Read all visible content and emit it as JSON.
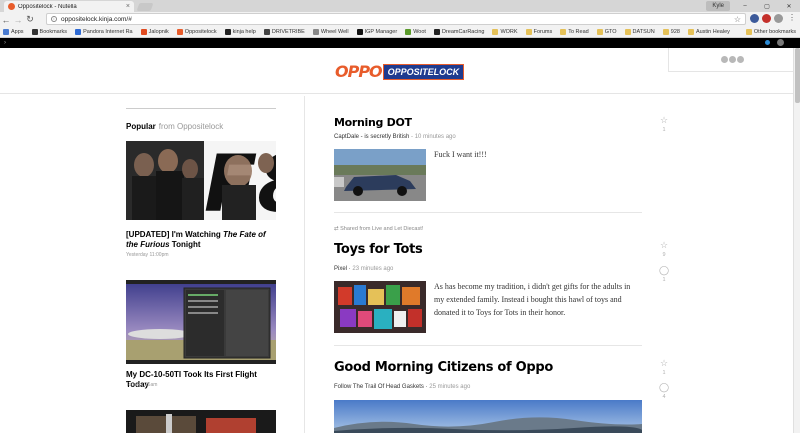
{
  "browser": {
    "tab_title": "Oppositelock - Nutella",
    "user_label": "Kyle",
    "url": "oppositelock.kinja.com/#",
    "bookmarks": [
      {
        "label": "Apps",
        "color": "#4a7bd0"
      },
      {
        "label": "Bookmarks",
        "color": "#333333"
      },
      {
        "label": "Pandora Internet Ra",
        "color": "#2e6ad3"
      },
      {
        "label": "Jalopnik",
        "color": "#e04a1f"
      },
      {
        "label": "Oppositelock",
        "color": "#e85c2b"
      },
      {
        "label": "kinja help",
        "color": "#222222"
      },
      {
        "label": "DRIVETRIBE",
        "color": "#444444"
      },
      {
        "label": "Wheel Well",
        "color": "#888888"
      },
      {
        "label": "IGP Manager",
        "color": "#111111"
      },
      {
        "label": "Woot",
        "color": "#5a9a2a"
      },
      {
        "label": "DreamCarRacing",
        "color": "#222222"
      },
      {
        "label": "WORK",
        "color": "#e5c158"
      },
      {
        "label": "Forums",
        "color": "#e5c158"
      },
      {
        "label": "To Read",
        "color": "#e5c158"
      },
      {
        "label": "GTO",
        "color": "#e5c158"
      },
      {
        "label": "DATSUN",
        "color": "#e5c158"
      },
      {
        "label": "928",
        "color": "#e5c158"
      },
      {
        "label": "Austin Healey",
        "color": "#e5c158"
      }
    ],
    "other_bookmarks": "Other bookmarks"
  },
  "site": {
    "logo_left": "OPPO",
    "logo_right": "OPPOSITELOCK"
  },
  "sidebar": {
    "heading": "Popular",
    "heading_from": "from Oppositelock",
    "items": [
      {
        "title_a": "[UPDATED] I'm Watching ",
        "title_i": "The Fate of the Furious",
        "title_b": " Tonight",
        "meta": "Yesterday 11:00pm"
      },
      {
        "title_a": "My DC-10-50TI Took Its First Flight Today",
        "title_i": "",
        "title_b": "",
        "meta": "Today 1:16am"
      }
    ]
  },
  "feed": {
    "posts": [
      {
        "title": "Morning DOT",
        "author": "CaptDale - is secretly British",
        "time": "10 minutes ago",
        "excerpt": "Fuck I want it!!!",
        "stars": "1",
        "comments": ""
      },
      {
        "shared": "Shared from Live and Let Diecast!",
        "title": "Toys for Tots",
        "author": "Pixel",
        "time": "23 minutes ago",
        "excerpt": "As has become my tradition, i didn't get gifts for the adults in my extended family. Instead i bought this hawl of toys and donated it to Toys for Tots in their honor.",
        "stars": "9",
        "comments": "1"
      },
      {
        "title": "Good Morning Citizens of Oppo",
        "author": "Follow The Trail Of Head Gaskets",
        "time": "25 minutes ago",
        "excerpt": "",
        "stars": "1",
        "comments": "4"
      }
    ]
  }
}
